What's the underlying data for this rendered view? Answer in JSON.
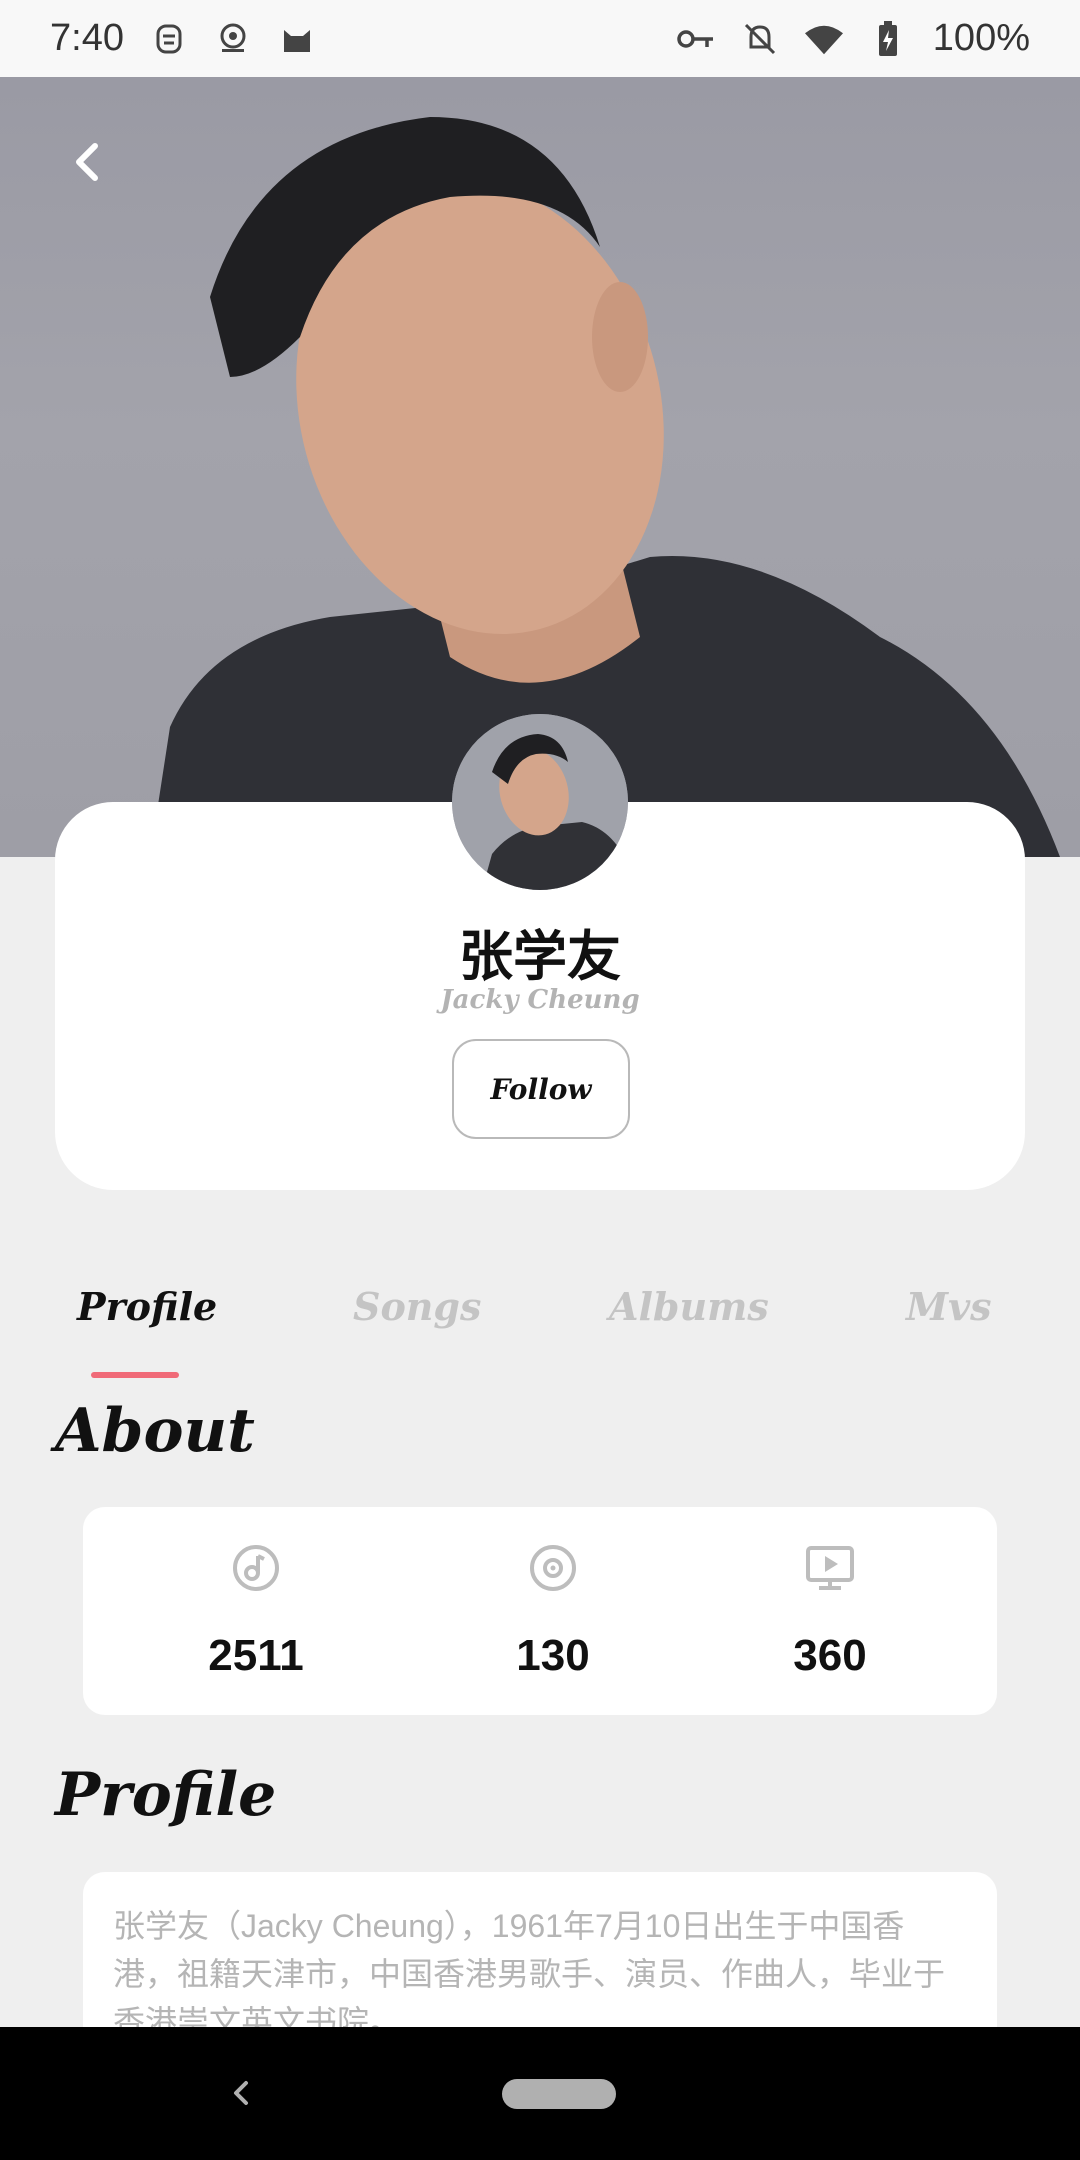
{
  "status_bar": {
    "time": "7:40",
    "battery": "100%",
    "icons": [
      "notification-app-icon",
      "radio-app-icon",
      "cat-app-icon",
      "key-icon",
      "bell-off-icon",
      "wifi-icon",
      "battery-charging-icon"
    ]
  },
  "artist": {
    "name": "张学友",
    "english_name": "Jacky Cheung",
    "follow_label": "Follow"
  },
  "tabs": [
    {
      "label": "Profile",
      "active": true
    },
    {
      "label": "Songs",
      "active": false
    },
    {
      "label": "Albums",
      "active": false
    },
    {
      "label": "Mvs",
      "active": false
    }
  ],
  "about": {
    "title": "About",
    "stats": [
      {
        "icon": "music-note-disc-icon",
        "value": "2511"
      },
      {
        "icon": "album-disc-icon",
        "value": "130"
      },
      {
        "icon": "mv-play-icon",
        "value": "360"
      }
    ]
  },
  "profile": {
    "title": "Profile",
    "bio": "张学友（Jacky Cheung），1961年7月10日出生于中国香港，祖籍天津市，中国香港男歌手、演员、作曲人，毕业于香港崇文英文书院。"
  },
  "colors": {
    "accent": "#f06a78",
    "page_bg": "#efefef",
    "inactive_tab": "#c4c4c4"
  }
}
